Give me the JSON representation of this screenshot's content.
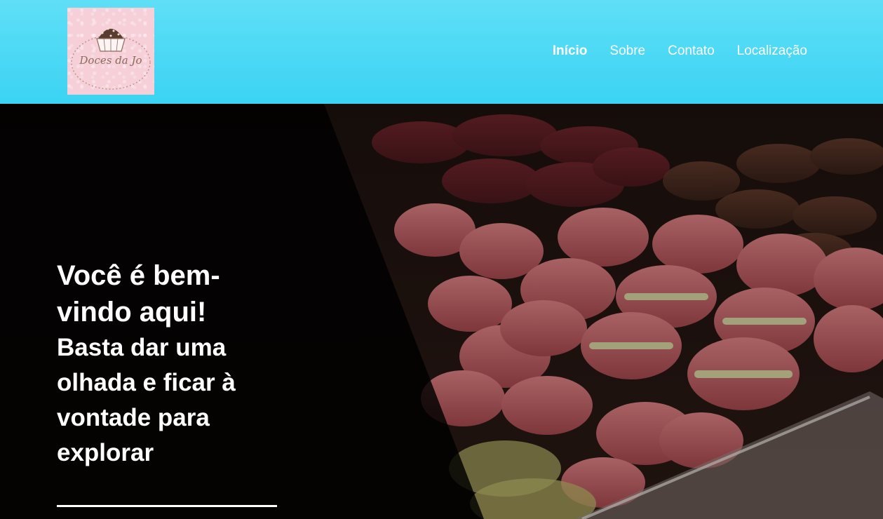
{
  "brand": {
    "logo_text": "Doces da Jo",
    "logo_icon": "cupcake-icon"
  },
  "nav": {
    "items": [
      {
        "label": "Início",
        "active": true
      },
      {
        "label": "Sobre",
        "active": false
      },
      {
        "label": "Contato",
        "active": false
      },
      {
        "label": "Localização",
        "active": false
      }
    ]
  },
  "hero": {
    "title": "Você é bem-vindo aqui!",
    "subtitle": "Basta dar uma olhada e ficar à vontade para explorar",
    "image": "macarons-photo"
  },
  "colors": {
    "header": "#3bd3f4",
    "nav_text": "#ffffff",
    "overlay": "#000000",
    "macaron": "#d06a6e"
  }
}
